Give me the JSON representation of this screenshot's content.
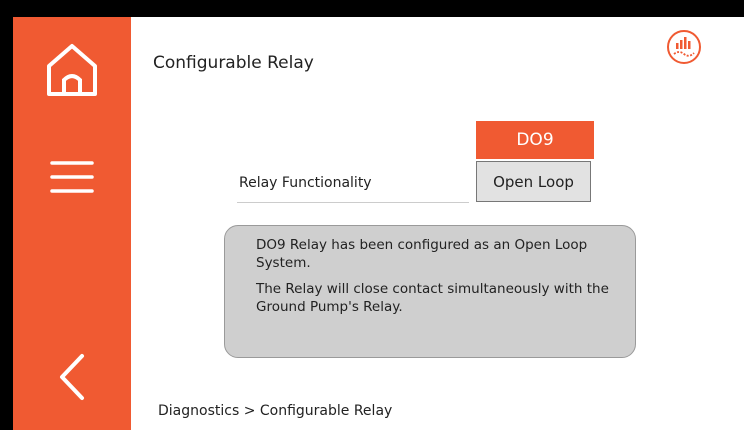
{
  "header": {
    "title": "Configurable Relay"
  },
  "sidebar": {
    "icons": [
      "home-icon",
      "menu-icon",
      "back-icon"
    ],
    "accent_color": "#f05a32"
  },
  "relay": {
    "label": "Relay Functionality",
    "output_tag": "DO9",
    "mode_value": "Open Loop"
  },
  "info": {
    "line1": "DO9 Relay has been configured as an Open Loop System.",
    "line2": "The Relay will close contact simultaneously with the Ground Pump's Relay."
  },
  "breadcrumb": "Diagnostics > Configurable Relay"
}
